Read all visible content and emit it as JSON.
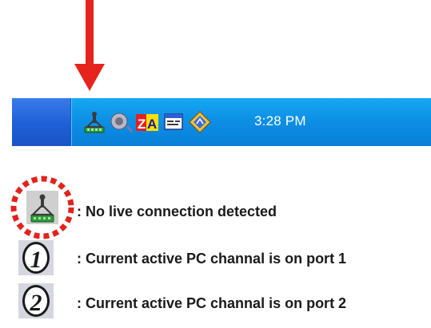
{
  "taskbar": {
    "tray_icons": [
      "kvm-network-icon",
      "volume-icon",
      "zonealarm-icon",
      "window-app-icon",
      "diamond-app-icon"
    ],
    "time": "3:28 PM"
  },
  "legend": [
    {
      "icon": "kvm-no-connection-icon",
      "text": ": No live connection detected"
    },
    {
      "icon": "port-1-icon",
      "text": ": Current active PC channal is on port 1"
    },
    {
      "icon": "port-2-icon",
      "text": ": Current active PC channal is on port 2"
    }
  ],
  "colors": {
    "arrow": "#e6231c",
    "taskbar_blue": "#1f5fd6",
    "tray_blue": "#0c8ee4",
    "highlight_circle": "#e0231c"
  }
}
